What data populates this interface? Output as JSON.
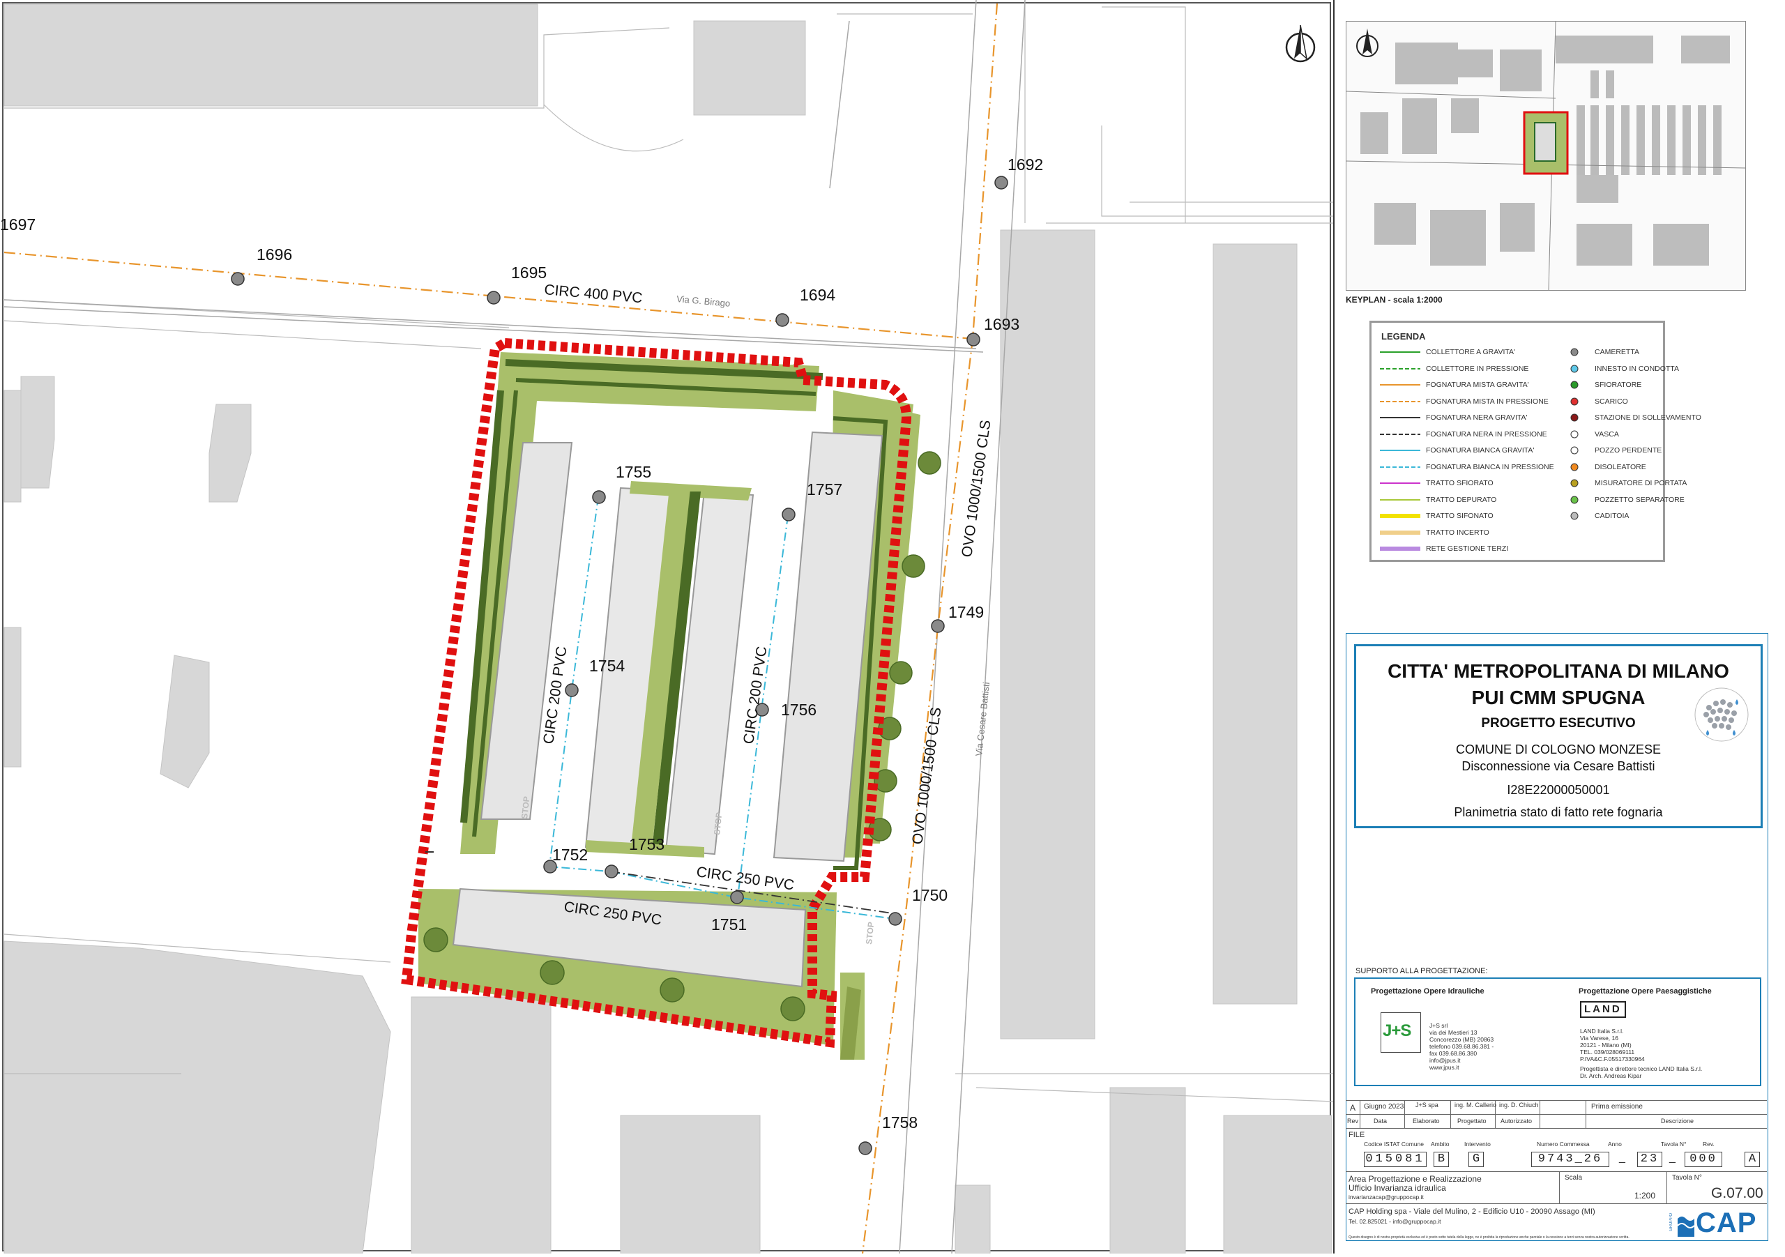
{
  "map": {
    "street_labels": [
      "Via G. Birago",
      "Via Cesare Battisti"
    ],
    "pipe_labels": [
      "CIRC 400 PVC",
      "CIRC 200 PVC",
      "CIRC 200 PVC",
      "CIRC 250 PVC",
      "CIRC 250 PVC",
      "OVO 1000/1500 CLS",
      "OVO 1000/1500 CLS"
    ],
    "manholes": [
      "1697",
      "1696",
      "1695",
      "1694",
      "1693",
      "1692",
      "1749",
      "1750",
      "1751",
      "1752",
      "1753",
      "1754",
      "1755",
      "1756",
      "1757",
      "1758"
    ],
    "stop_marks": [
      "STOP",
      "STOP",
      "STOP"
    ],
    "colors": {
      "mixed_gravity": "#e8952c",
      "white_gravity": "#3bb8d8",
      "boundary": "#e01010",
      "green": "#a9bf6a",
      "hedge": "#4a6b25",
      "building": "#d6d6d6"
    }
  },
  "keyplan": {
    "caption": "KEYPLAN - scala 1:2000",
    "icon": "north-arrow-icon"
  },
  "legend": {
    "title": "LEGENDA",
    "lines": [
      {
        "label": "COLLETTORE A GRAVITA'",
        "color": "#2aa12a",
        "style": "solid"
      },
      {
        "label": "COLLETTORE IN PRESSIONE",
        "color": "#2aa12a",
        "style": "dash"
      },
      {
        "label": "FOGNATURA MISTA GRAVITA'",
        "color": "#e8952c",
        "style": "solid"
      },
      {
        "label": "FOGNATURA MISTA IN PRESSIONE",
        "color": "#e8952c",
        "style": "dash"
      },
      {
        "label": "FOGNATURA NERA GRAVITA'",
        "color": "#333333",
        "style": "solid"
      },
      {
        "label": "FOGNATURA NERA IN PRESSIONE",
        "color": "#333333",
        "style": "dash"
      },
      {
        "label": "FOGNATURA BIANCA GRAVITA'",
        "color": "#3bb8d8",
        "style": "solid"
      },
      {
        "label": "FOGNATURA BIANCA IN PRESSIONE",
        "color": "#3bb8d8",
        "style": "dash"
      },
      {
        "label": "TRATTO SFIORATO",
        "color": "#cc33cc",
        "style": "solid"
      },
      {
        "label": "TRATTO DEPURATO",
        "color": "#a8c83a",
        "style": "solid"
      },
      {
        "label": "TRATTO SIFONATO",
        "color": "#f2e200",
        "style": "thick"
      },
      {
        "label": "TRATTO INCERTO",
        "color": "#f0cf8a",
        "style": "thick"
      },
      {
        "label": "RETE GESTIONE TERZI",
        "color": "#b98ae0",
        "style": "thick"
      }
    ],
    "symbols": [
      {
        "label": "CAMERETTA",
        "color": "#8a8a8a"
      },
      {
        "label": "INNESTO IN CONDOTTA",
        "color": "#5ec8e8"
      },
      {
        "label": "SFIORATORE",
        "color": "#2a9a2a"
      },
      {
        "label": "SCARICO",
        "color": "#e03030"
      },
      {
        "label": "STAZIONE DI SOLLEVAMENTO",
        "color": "#8b1a1a"
      },
      {
        "label": "VASCA",
        "color": "#ffffff"
      },
      {
        "label": "POZZO PERDENTE",
        "color": "#ffffff"
      },
      {
        "label": "DISOLEATORE",
        "color": "#f08a20"
      },
      {
        "label": "MISURATORE DI PORTATA",
        "color": "#b8a020"
      },
      {
        "label": "POZZETTO SEPARATORE",
        "color": "#6ac24a"
      },
      {
        "label": "CADITOIA",
        "color": "#bbbbbb"
      }
    ]
  },
  "title_block": {
    "line1": "CITTA' METROPOLITANA DI MILANO",
    "line2": "PUI CMM SPUGNA",
    "line3": "PROGETTO ESECUTIVO",
    "line4": "COMUNE DI COLOGNO MONZESE",
    "line5": "Disconnessione via Cesare Battisti",
    "code": "I28E22000050001",
    "drawing": "Planimetria stato di fatto rete fognaria"
  },
  "support": {
    "heading": "SUPPORTO ALLA PROGETTAZIONE:",
    "hyd_title": "Progettazione Opere Idrauliche",
    "hyd_logo": "J+S",
    "hyd_lines": [
      "J+S srl",
      "via dei Mestieri 13",
      "Concorezzo (MB) 20863",
      "telefono 039.68.86.381 -",
      "fax 039.68.86.380",
      "info@jpus.it",
      "www.jpus.it"
    ],
    "land_title": "Progettazione Opere Paesaggistiche",
    "land_logo": "LAND",
    "land_lines": [
      "LAND Italia S.r.l.",
      "Via Varese, 16",
      "20121 - Milano (MI)",
      "TEL. 039/028069111",
      "P.IVA&C.F.05517330964"
    ],
    "land_extra": [
      "Progettista e direttore tecnico LAND Italia S.r.l.",
      "Dr. Arch. Andreas Kipar"
    ]
  },
  "revision": {
    "row": [
      "A",
      "Giugno 2023",
      "J+S spa",
      "ing. M. Callerio",
      "ing. D. Chiuch",
      "Prima emissione"
    ],
    "headers": [
      "Rev",
      "Data",
      "Elaborato",
      "Progettato",
      "Autorizzato",
      "Descrizione"
    ]
  },
  "file": {
    "label": "FILE",
    "headers": [
      "Codice ISTAT Comune",
      "Ambito",
      "Intervento",
      "Numero Commessa",
      "Anno",
      "Tavola N°",
      "Rev."
    ],
    "values": [
      "015081",
      "B",
      "G",
      "9743_26",
      "23",
      "000",
      "A"
    ]
  },
  "footer": {
    "office1": "Area Progettazione e Realizzazione",
    "office2": "Ufficio Invarianza idraulica",
    "email": "invarianzacap@gruppocap.it",
    "scale_label": "Scala",
    "scale": "1:200",
    "tavola_label": "Tavola N°",
    "tavola": "G.07.00",
    "company": "CAP Holding spa - Viale del Mulino, 2 - Edificio U10 - 20090 Assago (MI)",
    "tel": "Tel. 02.825021 - info@gruppocap.it",
    "disclaimer": "Questo disegno è di nostra proprietà esclusiva ed è posto sotto tutela della legge, ne è proibita la riproduzione anche parziale o la cessione a terzi senza nostra autorizzazione scritta.",
    "logo": "CAP",
    "group": "GRUPPO"
  }
}
